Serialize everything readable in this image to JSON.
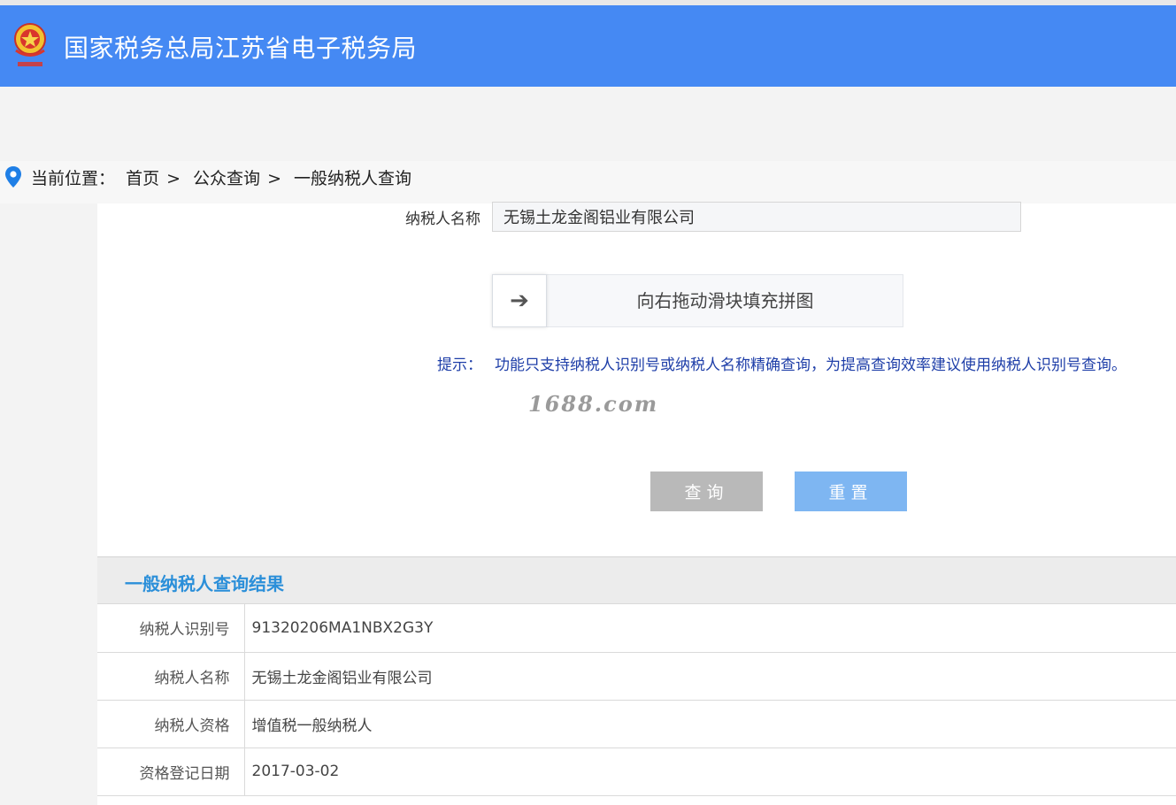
{
  "header": {
    "title": "国家税务总局江苏省电子税务局",
    "logo_icon": "tax-emblem-icon",
    "brand_color": "#4589f3"
  },
  "breadcrumb": {
    "prefix": "当前位置：",
    "items": [
      "首页",
      "公众查询",
      "一般纳税人查询"
    ],
    "separator": ">"
  },
  "form": {
    "name_label": "纳税人名称",
    "name_value": "无锡土龙金阁铝业有限公司",
    "slider_text": "向右拖动滑块填充拼图",
    "slider_icon": "arrow-right-icon",
    "hint_label": "提示：",
    "hint_text": "功能只支持纳税人识别号或纳税人名称精确查询，为提高查询效率建议使用纳税人识别号查询。",
    "query_button": "查询",
    "reset_button": "重置"
  },
  "watermark": "1688.com",
  "result": {
    "title": "一般纳税人查询结果",
    "rows": [
      {
        "label": "纳税人识别号",
        "value": "91320206MA1NBX2G3Y"
      },
      {
        "label": "纳税人名称",
        "value": "无锡土龙金阁铝业有限公司"
      },
      {
        "label": "纳税人资格",
        "value": "增值税一般纳税人"
      },
      {
        "label": "资格登记日期",
        "value": "2017-03-02"
      }
    ]
  }
}
